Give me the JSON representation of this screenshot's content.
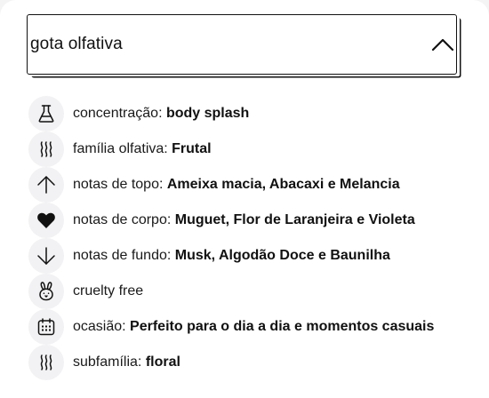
{
  "accordion": {
    "title": "gota olfativa",
    "toggle_icon": "chevron-up-icon"
  },
  "attributes": [
    {
      "icon": "flask-icon",
      "label": "concentração",
      "separator": ": ",
      "value": "body splash"
    },
    {
      "icon": "scent-waves-icon",
      "label": "família olfativa",
      "separator": ": ",
      "value": "Frutal"
    },
    {
      "icon": "arrow-up-icon",
      "label": "notas de topo",
      "separator": ": ",
      "value": "Ameixa macia, Abacaxi e Melancia"
    },
    {
      "icon": "heart-icon",
      "label": "notas de corpo",
      "separator": ": ",
      "value": "Muguet, Flor de Laranjeira e Violeta"
    },
    {
      "icon": "arrow-down-icon",
      "label": "notas de fundo",
      "separator": ": ",
      "value": "Musk, Algodão Doce e Baunilha"
    },
    {
      "icon": "bunny-icon",
      "label": "cruelty free",
      "separator": "",
      "value": ""
    },
    {
      "icon": "calendar-icon",
      "label": "ocasião",
      "separator": ": ",
      "value": "Perfeito para o dia a dia e momentos casuais"
    },
    {
      "icon": "scent-waves-icon",
      "label": "subfamília",
      "separator": ": ",
      "value": "floral"
    }
  ],
  "colors": {
    "text": "#111111",
    "icon_background": "#f2f2f4",
    "page_background": "#f4f4f5"
  }
}
